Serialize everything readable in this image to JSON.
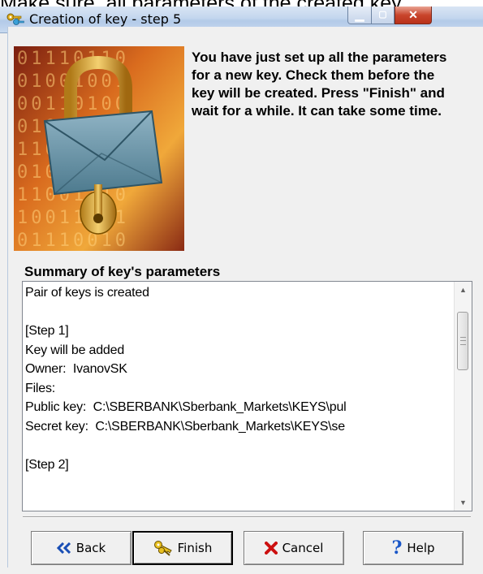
{
  "caption": "Make sure, all parameters of the created key",
  "window": {
    "title": "Creation of key - step 5"
  },
  "intro_text": "You have just set up all the parameters for a new key. Check them before the key will be created. Press \"Finish\" and wait for a while. It can take some time.",
  "summary": {
    "label": "Summary of key's parameters",
    "lines": [
      "Pair of keys is created",
      "",
      "[Step 1]",
      "Key will be added",
      "Owner:  IvanovSK",
      "Files:",
      "Public key:  C:\\SBERBANK\\Sberbank_Markets\\KEYS\\pul",
      "Secret key:  C:\\SBERBANK\\Sberbank_Markets\\KEYS\\se",
      "",
      "[Step 2]"
    ]
  },
  "buttons": {
    "back": "Back",
    "finish": "Finish",
    "cancel": "Cancel",
    "help": "Help"
  },
  "illustration": {
    "digits": [
      "01110110",
      "01001001",
      "00110100",
      "01010101",
      "11000011",
      "01010100",
      "11001110",
      "10011101",
      "01110010"
    ]
  },
  "icons": {
    "app": "key-icon",
    "back": "double-chevron-left-icon",
    "finish": "keys-icon",
    "cancel": "red-x-icon",
    "help": "question-mark-icon"
  },
  "colors": {
    "titlebar": "#c3d6ee",
    "close_button": "#c9452c",
    "back_arrow": "#1a4fb5",
    "cancel_x": "#cc1010",
    "help_mark": "#1a57c8"
  }
}
